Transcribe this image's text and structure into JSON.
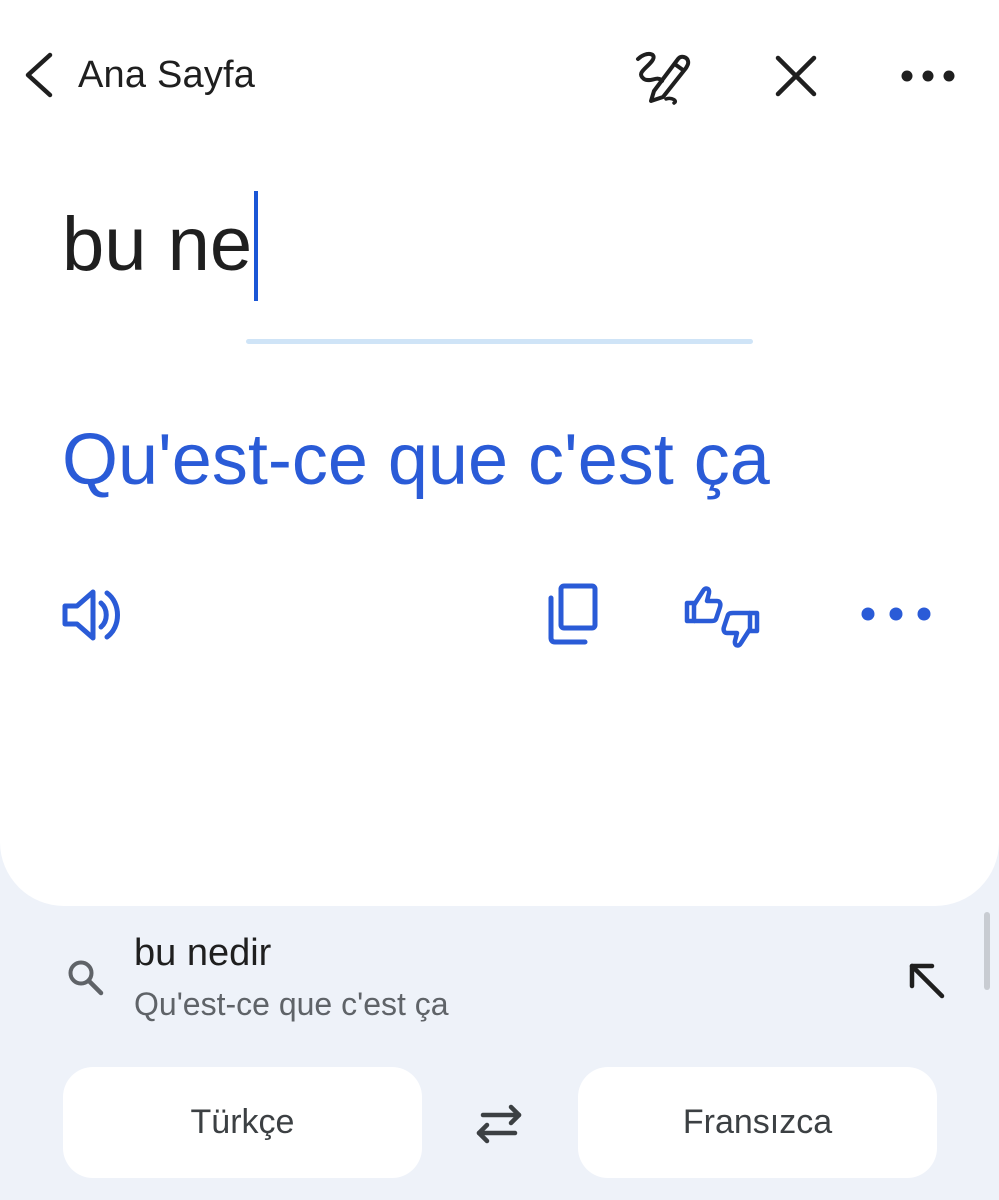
{
  "header": {
    "back_label": "Ana Sayfa"
  },
  "input": {
    "text": "bu ne"
  },
  "translation": {
    "text": "Qu'est-ce que c'est ça"
  },
  "suggestion": {
    "title": "bu nedir",
    "subtitle": "Qu'est-ce que c'est ça"
  },
  "languages": {
    "source": "Türkçe",
    "target": "Fransızca"
  },
  "colors": {
    "accent": "#2a5bd7",
    "text_primary": "#1f1f1f",
    "text_secondary": "#5f6368",
    "background": "#eef2f9",
    "divider": "#cfe4f7"
  },
  "icons": {
    "back": "chevron-left-icon",
    "handwriting": "handwriting-pen-icon",
    "close": "close-icon",
    "menu": "more-horizontal-icon",
    "speaker": "speaker-icon",
    "copy": "copy-icon",
    "rate": "thumbs-up-down-icon",
    "more": "more-horizontal-icon",
    "search": "search-icon",
    "fill": "arrow-up-left-icon",
    "swap": "swap-arrows-icon"
  }
}
